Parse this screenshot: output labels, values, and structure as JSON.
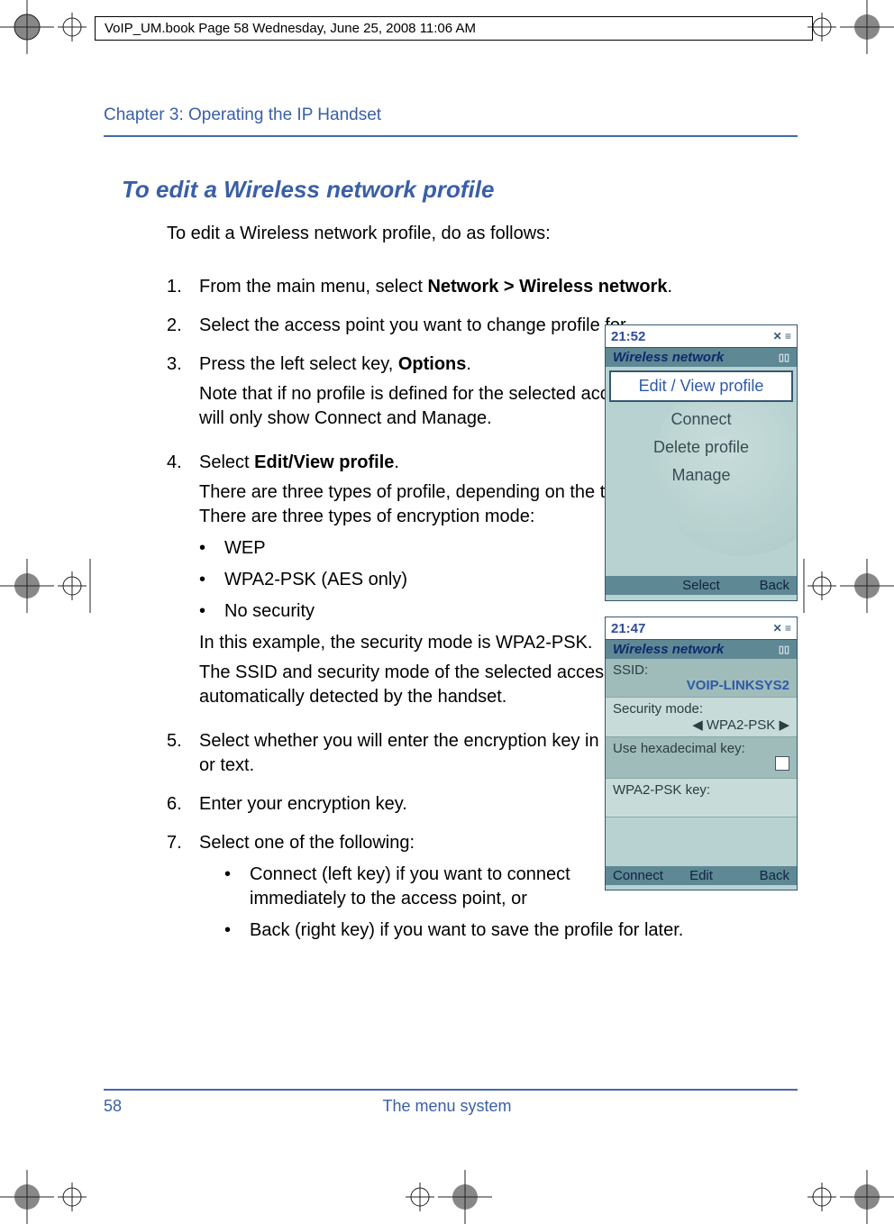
{
  "crop_header": "VoIP_UM.book  Page 58  Wednesday, June 25, 2008  11:06 AM",
  "chapter": "Chapter 3:  Operating the IP Handset",
  "heading": "To edit a Wireless network profile",
  "intro": "To edit a Wireless network profile, do as follows:",
  "steps": {
    "s1": {
      "n": "1.",
      "text_a": "From the main menu, select ",
      "bold": "Network > Wireless network",
      "text_b": "."
    },
    "s2": {
      "n": "2.",
      "text": "Select the access point you want to change profile for."
    },
    "s3": {
      "n": "3.",
      "line1_a": "Press the left select key, ",
      "line1_bold": "Options",
      "line1_b": ".",
      "line2": "Note that if no profile is defined for the selected access point, this menu will only show Connect and Manage."
    },
    "s4": {
      "n": "4.",
      "line1_a": "Select ",
      "line1_bold": "Edit/View profile",
      "line1_b": ".",
      "line2": "There are three types of profile, depending on the type of encryption used. There are three types of encryption mode:",
      "enc": {
        "a": "WEP",
        "b": "WPA2-PSK (AES only)",
        "c": "No security"
      },
      "line3": "In this example, the security mode is WPA2-PSK.",
      "line4": "The SSID and security mode of the selected access point are automatically detected by the handset."
    },
    "s5": {
      "n": "5.",
      "text": "Select whether you will enter the encryption key in hexadecimal numbers or text."
    },
    "s6": {
      "n": "6.",
      "text": "Enter your encryption key."
    },
    "s7": {
      "n": "7.",
      "text": "Select one of the following:",
      "opts": {
        "a": "Connect (left key) if you want to connect immediately to the access point, or",
        "b": "Back (right key) if you want to save the profile for later."
      }
    }
  },
  "phone1": {
    "time": "21:52",
    "title": "Wireless network",
    "items": {
      "sel": "Edit / View profile",
      "b": "Connect",
      "c": "Delete profile",
      "d": "Manage"
    },
    "soft": {
      "mid": "Select",
      "right": "Back"
    }
  },
  "phone2": {
    "time": "21:47",
    "title": "Wireless network",
    "rows": {
      "ssid_l": "SSID:",
      "ssid_v": "VOIP-LINKSYS2",
      "sec_l": "Security mode:",
      "sec_v": "◀ WPA2-PSK ▶",
      "hex_l": "Use hexadecimal key:",
      "key_l": "WPA2-PSK key:"
    },
    "soft": {
      "left": "Connect",
      "mid": "Edit",
      "right": "Back"
    }
  },
  "page_number": "58",
  "footer": "The menu system"
}
